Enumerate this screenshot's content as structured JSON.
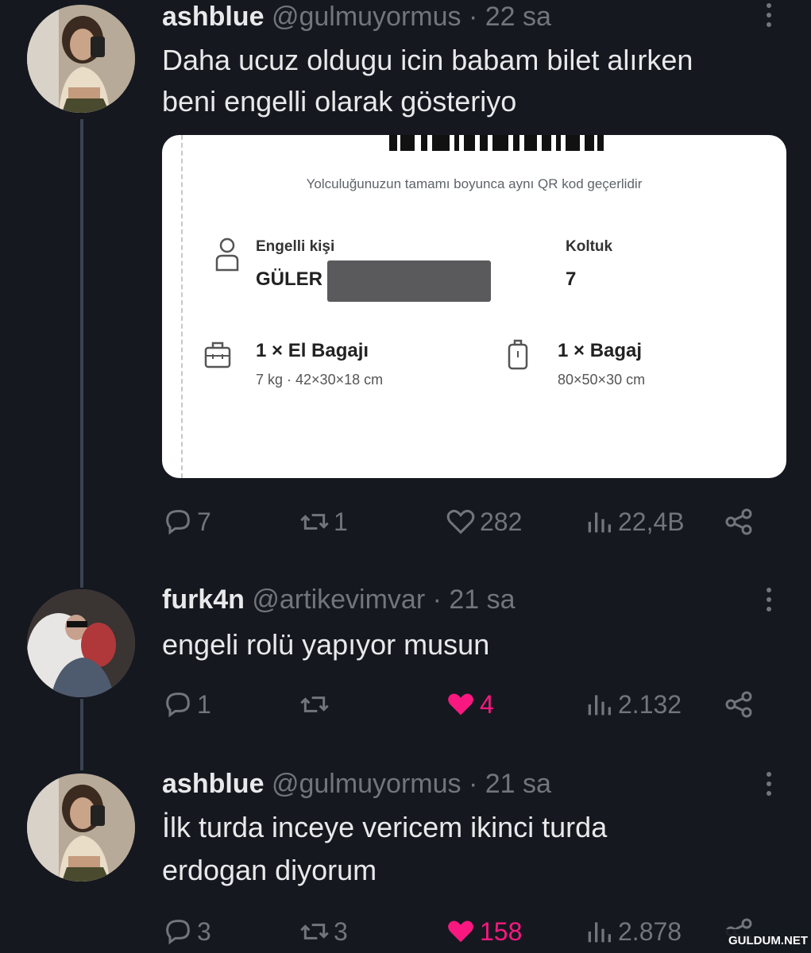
{
  "tweets": [
    {
      "name": "ashblue",
      "handle": "@gulmuyormus",
      "time": "· 22 sa",
      "lines": [
        "Daha ucuz oldugu icin babam bilet alırken",
        "beni engelli olarak gösteriyo"
      ],
      "replies": "7",
      "retweets": "1",
      "likes": "282",
      "views": "22,4B",
      "liked": false
    },
    {
      "name": "furk4n",
      "handle": "@artikevimvar",
      "time": "· 21 sa",
      "lines": [
        "engeli rolü yapıyor musun"
      ],
      "replies": "1",
      "retweets": "",
      "likes": "4",
      "views": "2.132",
      "liked": true
    },
    {
      "name": "ashblue",
      "handle": "@gulmuyormus",
      "time": "· 21 sa",
      "lines": [
        "İlk turda inceye vericem ikinci turda",
        "erdogan diyorum"
      ],
      "replies": "3",
      "retweets": "3",
      "likes": "158",
      "views": "2.878",
      "liked": true
    }
  ],
  "ticket": {
    "qr_note": "Yolculuğunuzun tamamı boyunca aynı QR kod geçerlidir",
    "passenger_label": "Engelli kişi",
    "passenger_name": "GÜLER",
    "seat_label": "Koltuk",
    "seat_value": "7",
    "hand_bag_title": "1 × El Bagajı",
    "hand_bag_detail": "7 kg · 42×30×18 cm",
    "bag_title": "1 × Bagaj",
    "bag_detail": "80×50×30 cm"
  },
  "icons": [
    "user-icon",
    "briefcase-icon",
    "luggage-icon",
    "reply-icon",
    "retweet-icon",
    "heart-icon",
    "views-icon",
    "share-icon",
    "more-icon"
  ],
  "colors": {
    "background": "#15181f",
    "text": "#e7e9ea",
    "muted": "#71767b",
    "like": "#f91880"
  },
  "watermark": "GULDUM.NET"
}
